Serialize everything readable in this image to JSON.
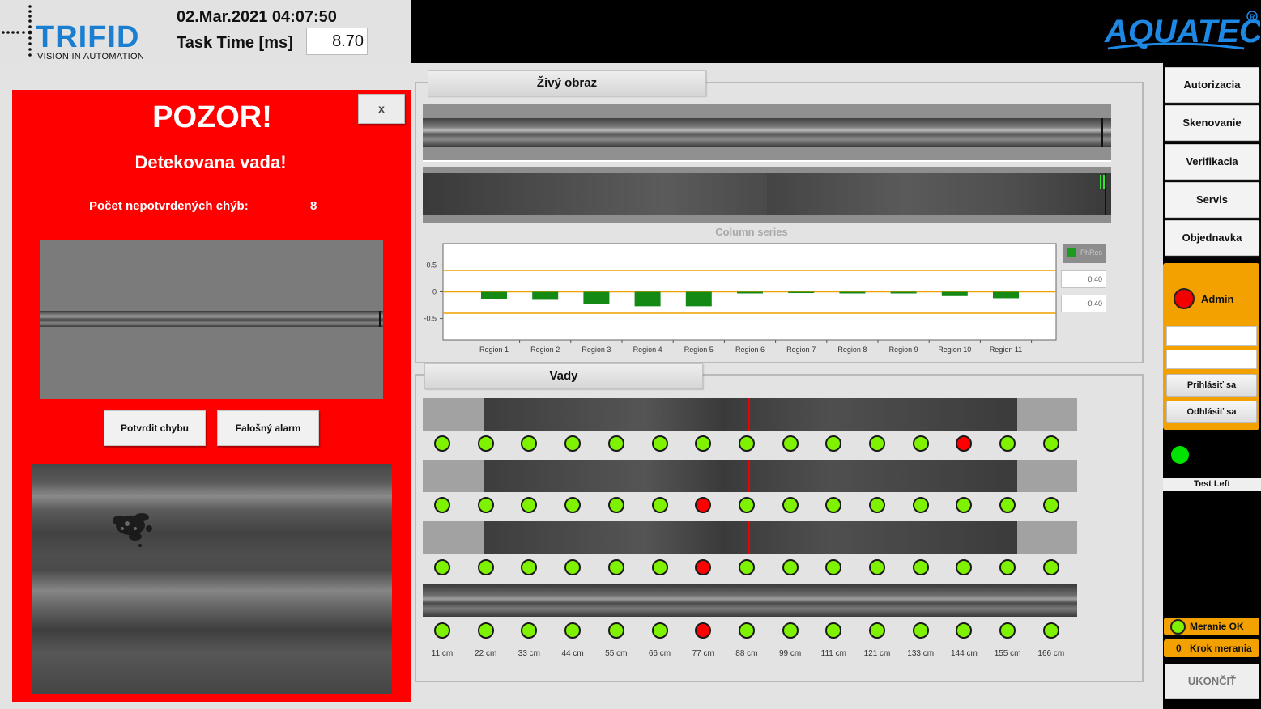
{
  "header": {
    "brand": "TRIFID",
    "brand_tagline": "VISION IN AUTOMATION",
    "datetime": "02.Mar.2021 04:07:50",
    "task_time_label": "Task Time [ms]",
    "task_time_value": "8.70",
    "customer_logo": "AQUATEC"
  },
  "alarm": {
    "title": "POZOR!",
    "subtitle": "Detekovana vada!",
    "count_label": "Počet nepotvrdených chýb:",
    "count_value": "8",
    "close_label": "x",
    "confirm_label": "Potvrdit chybu",
    "false_alarm_label": "Falošný alarm"
  },
  "live": {
    "tab_label": "Živý obraz"
  },
  "chart_data": {
    "type": "bar",
    "title": "Column series",
    "categories": [
      "Region 1",
      "Region 2",
      "Region 3",
      "Region 4",
      "Region 5",
      "Region 6",
      "Region 7",
      "Region 8",
      "Region 9",
      "Region 10",
      "Region 11"
    ],
    "series": [
      {
        "name": "PhRes",
        "values": [
          -0.13,
          -0.15,
          -0.22,
          -0.27,
          -0.27,
          -0.03,
          -0.01,
          -0.03,
          -0.03,
          -0.08,
          -0.12
        ]
      }
    ],
    "y_ticks": [
      "0.5",
      "0",
      "-0.5"
    ],
    "ylim": [
      -0.9,
      0.9
    ],
    "limits": {
      "upper": 0.4,
      "lower": -0.4,
      "upper_label": "0.40",
      "lower_label": "-0.40"
    },
    "colors": {
      "bar": "#148a14",
      "limit_line": "#f0a000"
    }
  },
  "defects": {
    "tab_label": "Vady",
    "distances": [
      "11 cm",
      "22 cm",
      "33 cm",
      "44 cm",
      "55 cm",
      "66 cm",
      "77 cm",
      "88 cm",
      "99 cm",
      "111 cm",
      "121 cm",
      "133 cm",
      "144 cm",
      "155 cm",
      "166 cm"
    ],
    "rows": [
      {
        "status": [
          "ok",
          "ok",
          "ok",
          "ok",
          "ok",
          "ok",
          "ok",
          "ok",
          "ok",
          "ok",
          "ok",
          "ok",
          "bad",
          "ok",
          "ok"
        ]
      },
      {
        "status": [
          "ok",
          "ok",
          "ok",
          "ok",
          "ok",
          "ok",
          "bad",
          "ok",
          "ok",
          "ok",
          "ok",
          "ok",
          "ok",
          "ok",
          "ok"
        ]
      },
      {
        "status": [
          "ok",
          "ok",
          "ok",
          "ok",
          "ok",
          "ok",
          "bad",
          "ok",
          "ok",
          "ok",
          "ok",
          "ok",
          "ok",
          "ok",
          "ok"
        ]
      },
      {
        "status": [
          "ok",
          "ok",
          "ok",
          "ok",
          "ok",
          "ok",
          "bad",
          "ok",
          "ok",
          "ok",
          "ok",
          "ok",
          "ok",
          "ok",
          "ok"
        ]
      }
    ]
  },
  "sidebar": {
    "nav": [
      "Autorizacia",
      "Skenovanie",
      "Verifikacia",
      "Servis",
      "Objednavka"
    ],
    "user_name": "Admin",
    "login_label": "Prihlásiť sa",
    "logout_label": "Odhlásiť sa",
    "test_label": "Test Left",
    "status_ok_label": "Meranie OK",
    "step_value": "0",
    "step_label": "Krok merania",
    "quit_label": "UKONČIŤ"
  }
}
